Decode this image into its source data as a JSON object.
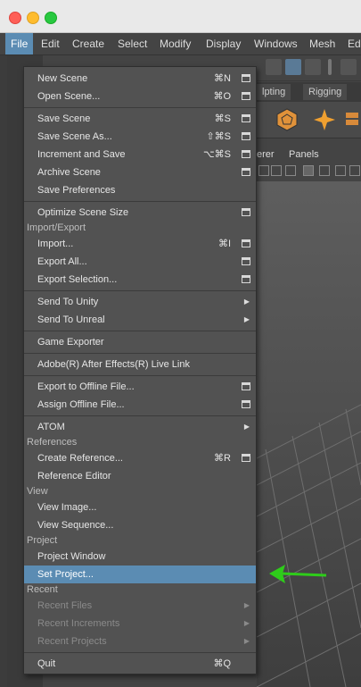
{
  "menubar": {
    "items": [
      "File",
      "Edit",
      "Create",
      "Select",
      "Modify",
      "Display",
      "Windows",
      "Mesh",
      "Edi"
    ]
  },
  "shelf": {
    "tabs": [
      "lpting",
      "Rigging"
    ]
  },
  "panel": {
    "menu": [
      "erer",
      "Panels"
    ]
  },
  "file_menu": {
    "items": {
      "new_scene": {
        "label": "New Scene",
        "shortcut": "⌘N"
      },
      "open_scene": {
        "label": "Open Scene...",
        "shortcut": "⌘O"
      },
      "save_scene": {
        "label": "Save Scene",
        "shortcut": "⌘S"
      },
      "save_scene_as": {
        "label": "Save Scene As...",
        "shortcut": "⇧⌘S"
      },
      "increment_save": {
        "label": "Increment and Save",
        "shortcut": "⌥⌘S"
      },
      "archive_scene": {
        "label": "Archive Scene"
      },
      "save_preferences": {
        "label": "Save Preferences"
      },
      "optimize_scene": {
        "label": "Optimize Scene Size"
      },
      "import": {
        "label": "Import...",
        "shortcut": "⌘I"
      },
      "export_all": {
        "label": "Export All..."
      },
      "export_selection": {
        "label": "Export Selection..."
      },
      "send_to_unity": {
        "label": "Send To Unity"
      },
      "send_to_unreal": {
        "label": "Send To Unreal"
      },
      "game_exporter": {
        "label": "Game Exporter"
      },
      "after_effects": {
        "label": "Adobe(R) After Effects(R) Live Link"
      },
      "export_offline": {
        "label": "Export to Offline File..."
      },
      "assign_offline": {
        "label": "Assign Offline File..."
      },
      "atom": {
        "label": "ATOM"
      },
      "create_reference": {
        "label": "Create Reference...",
        "shortcut": "⌘R"
      },
      "reference_editor": {
        "label": "Reference Editor"
      },
      "view_image": {
        "label": "View Image..."
      },
      "view_sequence": {
        "label": "View Sequence..."
      },
      "project_window": {
        "label": "Project Window"
      },
      "set_project": {
        "label": "Set Project..."
      },
      "recent_files": {
        "label": "Recent Files"
      },
      "recent_increments": {
        "label": "Recent Increments"
      },
      "recent_projects": {
        "label": "Recent Projects"
      },
      "quit": {
        "label": "Quit",
        "shortcut": "⌘Q"
      }
    },
    "sections": {
      "import_export": "Import/Export",
      "references": "References",
      "view": "View",
      "project": "Project",
      "recent": "Recent"
    },
    "highlighted": "Set Project..."
  },
  "colors": {
    "highlight": "#5b8cb3",
    "menu_bg": "#525252",
    "arrow": "#2ecc1a"
  }
}
